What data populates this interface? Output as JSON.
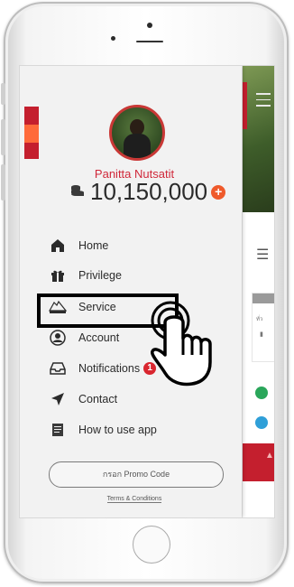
{
  "profile": {
    "name": "Panitta Nutsatit",
    "balance": "10,150,000",
    "coin_icon": "coin-stack-icon",
    "add_icon": "plus-icon"
  },
  "menu": {
    "items": [
      {
        "id": "home",
        "label": "Home",
        "icon": "home-icon"
      },
      {
        "id": "privilege",
        "label": "Privilege",
        "icon": "gift-icon"
      },
      {
        "id": "service",
        "label": "Service",
        "icon": "service-logo-icon"
      },
      {
        "id": "account",
        "label": "Account",
        "icon": "user-icon"
      },
      {
        "id": "notifications",
        "label": "Notifications",
        "icon": "inbox-icon",
        "badge": "1"
      },
      {
        "id": "contact",
        "label": "Contact",
        "icon": "paper-plane-icon"
      },
      {
        "id": "how_to",
        "label": "How to use app",
        "icon": "document-icon"
      }
    ],
    "highlighted": "service"
  },
  "promo": {
    "label": "กรอก Promo Code"
  },
  "terms": {
    "label": "Terms & Conditions"
  },
  "background_app": {
    "card_text": "ทั่ว",
    "icons": [
      "hamburger-icon",
      "coin-stack-icon"
    ]
  },
  "colors": {
    "accent_red": "#c41f2e",
    "accent_orange": "#ff6a3a",
    "name_red": "#d0283a",
    "plus_orange": "#ef5a2b",
    "drawer_bg": "#f2f2f2",
    "badge_red": "#d9262f"
  }
}
